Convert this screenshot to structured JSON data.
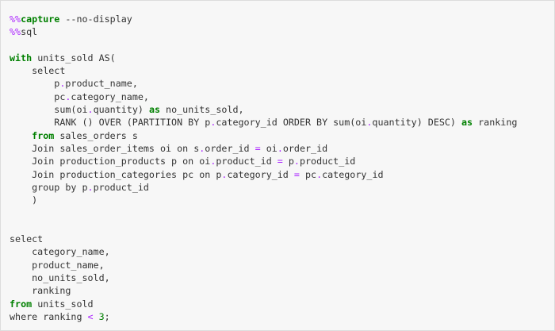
{
  "cell": {
    "lines": [
      {
        "segments": [
          {
            "t": "%%",
            "c": "magic"
          },
          {
            "t": "capture",
            "c": "kw"
          },
          {
            "t": " --no-display",
            "c": "plain"
          }
        ]
      },
      {
        "segments": [
          {
            "t": "%%",
            "c": "magic"
          },
          {
            "t": "sql",
            "c": "plain"
          }
        ]
      },
      {
        "segments": []
      },
      {
        "segments": [
          {
            "t": "with",
            "c": "kw"
          },
          {
            "t": " units_sold AS(",
            "c": "plain"
          }
        ]
      },
      {
        "segments": [
          {
            "t": "    select",
            "c": "plain"
          }
        ]
      },
      {
        "segments": [
          {
            "t": "        p",
            "c": "plain"
          },
          {
            "t": ".",
            "c": "op"
          },
          {
            "t": "product_name,",
            "c": "plain"
          }
        ]
      },
      {
        "segments": [
          {
            "t": "        pc",
            "c": "plain"
          },
          {
            "t": ".",
            "c": "op"
          },
          {
            "t": "category_name,",
            "c": "plain"
          }
        ]
      },
      {
        "segments": [
          {
            "t": "        sum(oi",
            "c": "plain"
          },
          {
            "t": ".",
            "c": "op"
          },
          {
            "t": "quantity) ",
            "c": "plain"
          },
          {
            "t": "as",
            "c": "kw"
          },
          {
            "t": " no_units_sold,",
            "c": "plain"
          }
        ]
      },
      {
        "segments": [
          {
            "t": "        RANK () OVER (PARTITION BY p",
            "c": "plain"
          },
          {
            "t": ".",
            "c": "op"
          },
          {
            "t": "category_id ORDER BY sum(oi",
            "c": "plain"
          },
          {
            "t": ".",
            "c": "op"
          },
          {
            "t": "quantity) DESC) ",
            "c": "plain"
          },
          {
            "t": "as",
            "c": "kw"
          },
          {
            "t": " ranking",
            "c": "plain"
          }
        ]
      },
      {
        "segments": [
          {
            "t": "    ",
            "c": "plain"
          },
          {
            "t": "from",
            "c": "kw"
          },
          {
            "t": " sales_orders s",
            "c": "plain"
          }
        ]
      },
      {
        "segments": [
          {
            "t": "    Join sales_order_items oi on s",
            "c": "plain"
          },
          {
            "t": ".",
            "c": "op"
          },
          {
            "t": "order_id ",
            "c": "plain"
          },
          {
            "t": "=",
            "c": "op"
          },
          {
            "t": " oi",
            "c": "plain"
          },
          {
            "t": ".",
            "c": "op"
          },
          {
            "t": "order_id",
            "c": "plain"
          }
        ]
      },
      {
        "segments": [
          {
            "t": "    Join production_products p on oi",
            "c": "plain"
          },
          {
            "t": ".",
            "c": "op"
          },
          {
            "t": "product_id ",
            "c": "plain"
          },
          {
            "t": "=",
            "c": "op"
          },
          {
            "t": " p",
            "c": "plain"
          },
          {
            "t": ".",
            "c": "op"
          },
          {
            "t": "product_id",
            "c": "plain"
          }
        ]
      },
      {
        "segments": [
          {
            "t": "    Join production_categories pc on p",
            "c": "plain"
          },
          {
            "t": ".",
            "c": "op"
          },
          {
            "t": "category_id ",
            "c": "plain"
          },
          {
            "t": "=",
            "c": "op"
          },
          {
            "t": " pc",
            "c": "plain"
          },
          {
            "t": ".",
            "c": "op"
          },
          {
            "t": "category_id",
            "c": "plain"
          }
        ]
      },
      {
        "segments": [
          {
            "t": "    group by p",
            "c": "plain"
          },
          {
            "t": ".",
            "c": "op"
          },
          {
            "t": "product_id",
            "c": "plain"
          }
        ]
      },
      {
        "segments": [
          {
            "t": "    )",
            "c": "plain"
          }
        ]
      },
      {
        "segments": []
      },
      {
        "segments": []
      },
      {
        "segments": [
          {
            "t": "select",
            "c": "plain"
          }
        ]
      },
      {
        "segments": [
          {
            "t": "    category_name,",
            "c": "plain"
          }
        ]
      },
      {
        "segments": [
          {
            "t": "    product_name,",
            "c": "plain"
          }
        ]
      },
      {
        "segments": [
          {
            "t": "    no_units_sold,",
            "c": "plain"
          }
        ]
      },
      {
        "segments": [
          {
            "t": "    ranking",
            "c": "plain"
          }
        ]
      },
      {
        "segments": [
          {
            "t": "from",
            "c": "kw"
          },
          {
            "t": " units_sold",
            "c": "plain"
          }
        ]
      },
      {
        "segments": [
          {
            "t": "where ranking ",
            "c": "plain"
          },
          {
            "t": "<",
            "c": "op"
          },
          {
            "t": " ",
            "c": "plain"
          },
          {
            "t": "3",
            "c": "num"
          },
          {
            "t": ";",
            "c": "plain"
          }
        ]
      }
    ]
  },
  "colors": {
    "keyword": "#008000",
    "operator": "#aa22ff",
    "magic": "#aa22ff",
    "number": "#008000",
    "text": "#333333",
    "cell_background": "#f7f7f7"
  }
}
